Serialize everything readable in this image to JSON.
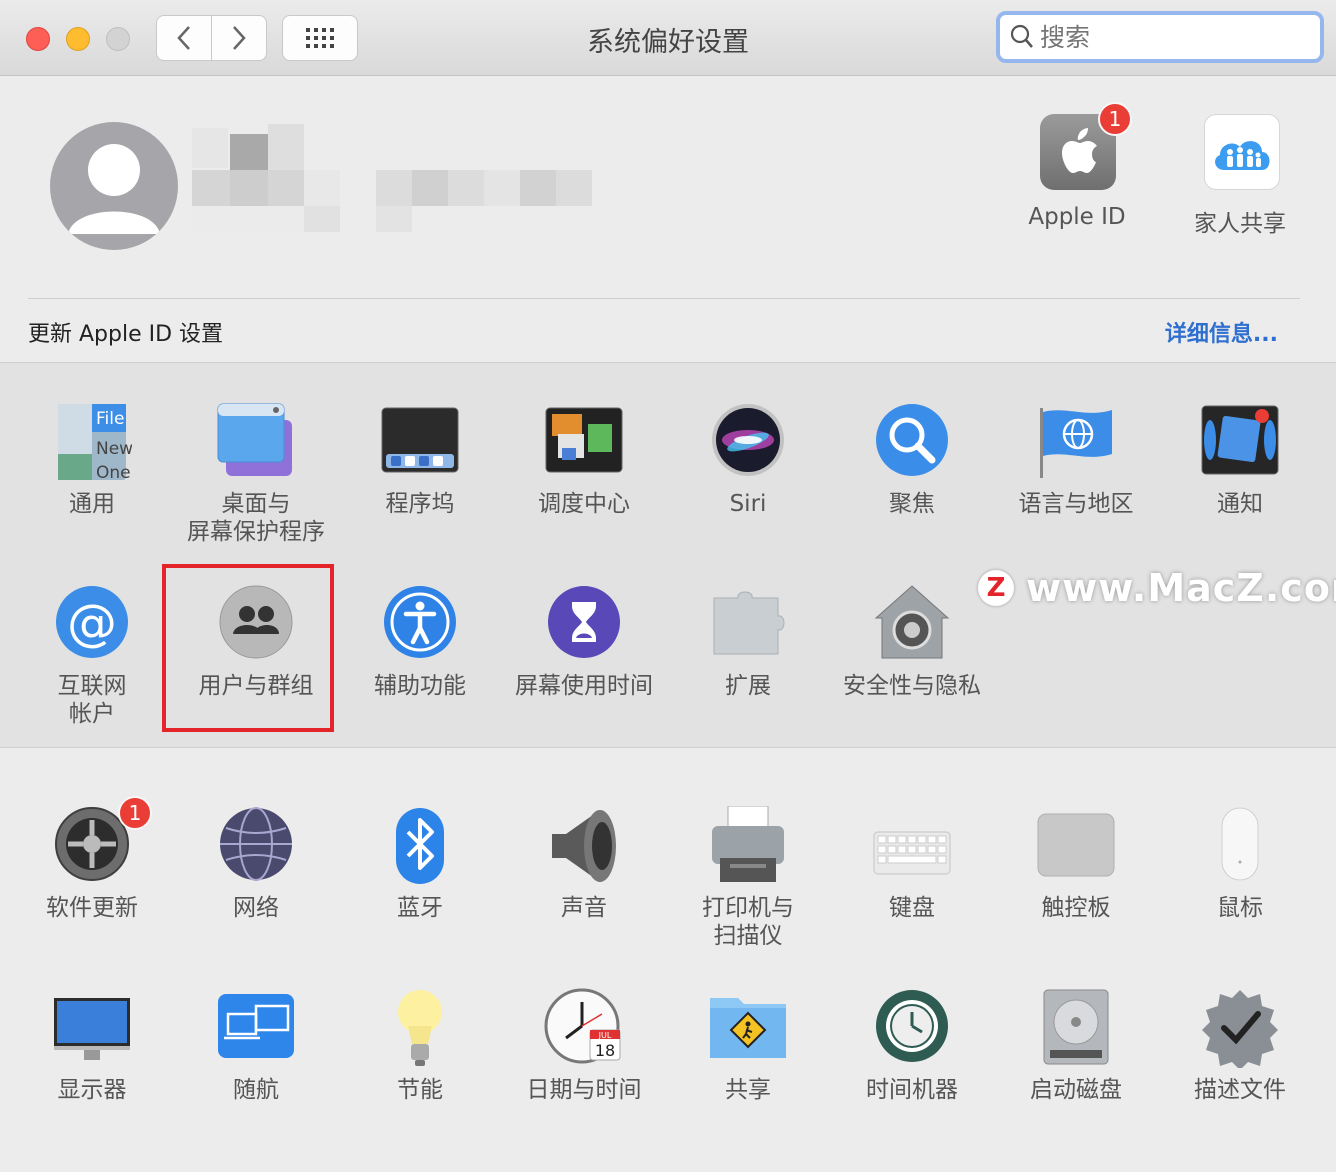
{
  "window": {
    "title": "系统偏好设置"
  },
  "search": {
    "placeholder": "搜索"
  },
  "account": {
    "apple_id_label": "Apple ID",
    "apple_id_badge": "1",
    "family_label": "家人共享",
    "update_notice": "更新 Apple ID 设置",
    "details_link": "详细信息..."
  },
  "panes_row1": [
    {
      "name": "general",
      "label": "通用"
    },
    {
      "name": "desktop-screensaver",
      "label": "桌面与\n屏幕保护程序"
    },
    {
      "name": "dock",
      "label": "程序坞"
    },
    {
      "name": "mission-control",
      "label": "调度中心"
    },
    {
      "name": "siri",
      "label": "Siri"
    },
    {
      "name": "spotlight",
      "label": "聚焦"
    },
    {
      "name": "language-region",
      "label": "语言与地区"
    },
    {
      "name": "notifications",
      "label": "通知"
    }
  ],
  "panes_row2": [
    {
      "name": "internet-accounts",
      "label": "互联网\n帐户"
    },
    {
      "name": "users-groups",
      "label": "用户与群组"
    },
    {
      "name": "accessibility",
      "label": "辅助功能"
    },
    {
      "name": "screen-time",
      "label": "屏幕使用时间"
    },
    {
      "name": "extensions",
      "label": "扩展"
    },
    {
      "name": "security-privacy",
      "label": "安全性与隐私"
    }
  ],
  "panes_row3": [
    {
      "name": "software-update",
      "label": "软件更新",
      "badge": "1"
    },
    {
      "name": "network",
      "label": "网络"
    },
    {
      "name": "bluetooth",
      "label": "蓝牙"
    },
    {
      "name": "sound",
      "label": "声音"
    },
    {
      "name": "printers-scanners",
      "label": "打印机与\n扫描仪"
    },
    {
      "name": "keyboard",
      "label": "键盘"
    },
    {
      "name": "trackpad",
      "label": "触控板"
    },
    {
      "name": "mouse",
      "label": "鼠标"
    }
  ],
  "panes_row4": [
    {
      "name": "displays",
      "label": "显示器"
    },
    {
      "name": "sidecar",
      "label": "随航"
    },
    {
      "name": "energy-saver",
      "label": "节能"
    },
    {
      "name": "date-time",
      "label": "日期与时间"
    },
    {
      "name": "sharing",
      "label": "共享"
    },
    {
      "name": "time-machine",
      "label": "时间机器"
    },
    {
      "name": "startup-disk",
      "label": "启动磁盘"
    },
    {
      "name": "profiles",
      "label": "描述文件"
    }
  ],
  "icon_text": {
    "general_file": "File",
    "general_new": "New",
    "general_one": "One",
    "calendar_month": "JUL",
    "calendar_day": "18"
  },
  "watermark": {
    "logo": "Z",
    "text": "www.MacZ.com"
  },
  "colors": {
    "accent": "#2f6fcf",
    "highlight": "#e3242b",
    "badge": "#ea3d35"
  }
}
